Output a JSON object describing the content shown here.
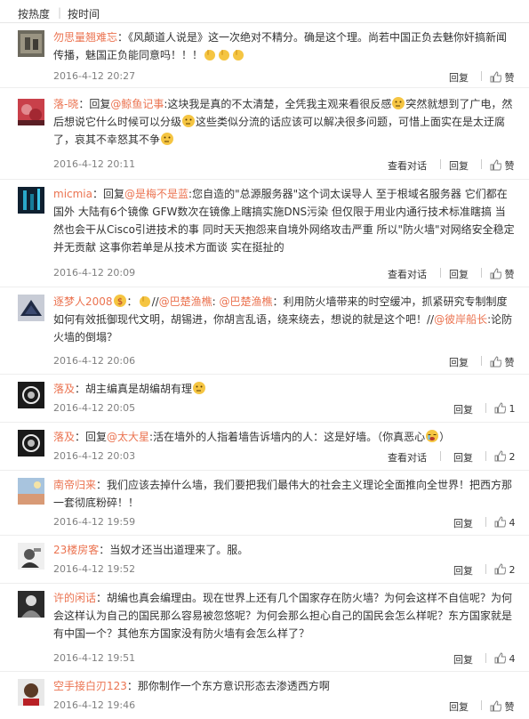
{
  "sort": {
    "hot": "按热度",
    "time": "按时间"
  },
  "actions": {
    "reply": "回复",
    "view_thread": "查看对话",
    "like_label": "赞"
  },
  "comments": [
    {
      "user": "勿思量翘难忘",
      "text": "：《风颠道人说是》这一次绝对不精分。确是这个理。尚若中国正负去魅你奸搞新闻传播，魅国正负能同意吗！！！",
      "time": "2016-4-12 20:27",
      "likes": ""
    },
    {
      "user": "落-晓",
      "pre": "：回复",
      "mention": "@鲸鱼记事",
      "text": ":这块我是真的不太清楚，全凭我主观来看很反感",
      "text2": "突然就想到了广电，然后想说它什么时候可以分级",
      "text3": "这些类似分流的话应该可以解决很多问题，可惜上面实在是太迂腐了，哀其不幸怒其不争",
      "time": "2016-4-12 20:11",
      "likes": ""
    },
    {
      "user": "micmia",
      "pre": "：回复",
      "mention": "@是梅不是蓝",
      "text": ":您自造的\"总源服务器\"这个词太误导人 至于根域名服务器 它们都在国外 大陆有6个镜像 GFW数次在镜像上瞎搞实施DNS污染 但仅限于用业内通行技术标准瞎搞 当然也会干从Cisco引进技术的事 同时天天抱怨来自境外网络攻击严重 所以\"防火墙\"对网络安全稳定并无贡献 这事你若单是从技术方面谈 实在挺扯的",
      "time": "2016-4-12 20:09",
      "likes": ""
    },
    {
      "user": "逐梦人2008",
      "pre": "：",
      "mid": "//",
      "mention": "@巴楚渔樵",
      "text_a": ": ",
      "mention2": "@巴楚渔樵",
      "text": "：利用防火墙带来的时空缓冲，抓紧研究专制制度如何有效抵御现代文明，胡锡进，你胡言乱语，绕来绕去，想说的就是这个吧！//",
      "mention3": "@彼岸船长",
      "text2": ":论防火墙的倒塌？",
      "time": "2016-4-12 20:06",
      "likes": ""
    },
    {
      "user": "落及",
      "text": "：胡主编真是胡编胡有理",
      "time": "2016-4-12 20:05",
      "likes": "1"
    },
    {
      "user": "落及",
      "pre": "：回复",
      "mention": "@太大星",
      "text": ":活在墙外的人指着墙告诉墙内的人：这是好墙。（你真恶心",
      "text2": "）",
      "time": "2016-4-12 20:03",
      "likes": "2"
    },
    {
      "user": "南帝归来",
      "text": "：我们应该去掉什么墙，我们要把我们最伟大的社会主义理论全面推向全世界！把西方那一套彻底粉碎！！",
      "time": "2016-4-12 19:59",
      "likes": "4"
    },
    {
      "user": "23楼房客",
      "text": "：当奴才还当出道理来了。服。",
      "time": "2016-4-12 19:52",
      "likes": "2"
    },
    {
      "user": "许的闲话",
      "text": "：胡编也真会编理由。现在世界上还有几个国家存在防火墙？为何会这样不自信呢？为何会这样认为自己的国民那么容易被忽悠呢？为何会那么担心自己的国民会怎么样呢？东方国家就是有中国一个？其他东方国家没有防火墙有会怎么样了？",
      "time": "2016-4-12 19:51",
      "likes": "4"
    },
    {
      "user": "空手接白刃123",
      "text": "：那你制作一个东方意识形态去渗透西方啊",
      "time": "2016-4-12 19:46",
      "likes": ""
    }
  ],
  "colors": {
    "username": "#eb7350",
    "time": "#808080",
    "text": "#333333",
    "border": "#eeeeee"
  }
}
